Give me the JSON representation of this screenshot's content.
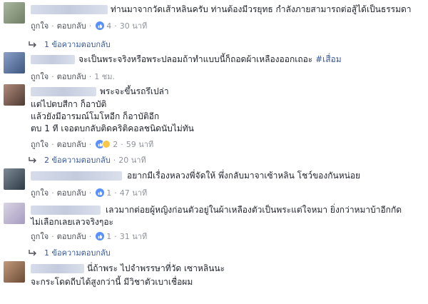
{
  "comments": [
    {
      "text": "ท่านมาจากวัดเส้าหลินครับ ท่านต้องมีวรยุทธ กำลังภายสามารถต่อสู้ได้เป็นธรรมดา",
      "like": "ถูกใจ",
      "reply": "ตอบกลับ",
      "reactions": "4",
      "time": "30 นาที",
      "replies": "1 ข้อความตอบกลับ",
      "replies_time": ""
    },
    {
      "text": "จะเป็นพระจริงหรือพระปลอมถ้าทำแบบนี้ก็ถอดผ้าเหลืองออกเถอะ",
      "hashtag": "#เสื่อม",
      "like": "ถูกใจ",
      "reply": "ตอบกลับ",
      "reactions": "",
      "time": "1 ชม."
    },
    {
      "text_lines": [
        "พระจะขึ้นรถรึเปล่า",
        "แต่ไปตบสีกา ก็อาบัติ",
        "แล้วยังมีอารมณ์โมโหอีก ก็อาบัติอีก",
        "ตบ 1 ที เจอตบกลับติดคริติคอลชนิดนับไม่ทัน"
      ],
      "like": "ถูกใจ",
      "reply": "ตอบกลับ",
      "reactions": "2",
      "time": "59 นาที",
      "replies": "2 ข้อความตอบกลับ",
      "replies_time": "20 นาที"
    },
    {
      "text": "อยากมีเรื่องหลวงพี่จัดให้ พึ่งกลับมาจาเซ้าหลิน โชว์ของกันหน่อย",
      "like": "ถูกใจ",
      "reply": "ตอบกลับ",
      "reactions": "1",
      "time": "47 นาที"
    },
    {
      "text_lines": [
        "เลวมากต่อยผู้หญิงก่อนตัวอยู่ในผ้าเหลืองตัวเป็นพระแต่ใจหมา ยิ่งกว่าหมาบ้าอีกกัด",
        "ไม่เลือกเลยเลวจริงๆอะ"
      ],
      "like": "ถูกใจ",
      "reply": "ตอบกลับ",
      "reactions": "1",
      "time": "31 นาที",
      "replies": "1 ข้อความตอบกลับ",
      "replies_time": ""
    },
    {
      "text_lines": [
        "นี่ถ้าพระ ไปจำพรรษาที่วัด เซาหลินนะ",
        "จะกระโดดถีบได้สูงกว่านี้ มีวิชาตัวเบาเชื่อผม"
      ]
    }
  ],
  "colors": {
    "link": "#365899",
    "meta": "#90949c",
    "text": "#1d2129",
    "like_blue": "#5890ff"
  }
}
